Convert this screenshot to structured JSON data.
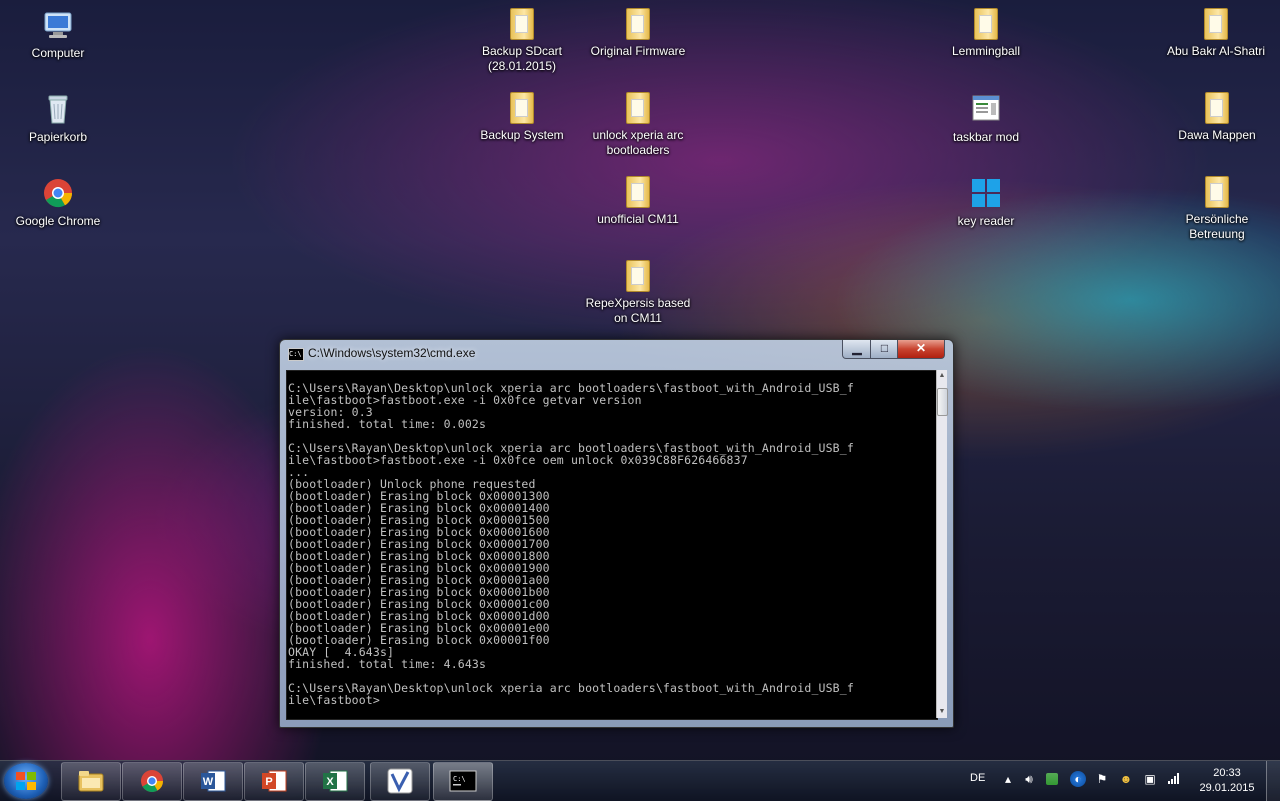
{
  "desktop": {
    "icons": [
      {
        "label": "Computer"
      },
      {
        "label": "Papierkorb"
      },
      {
        "label": "Google Chrome"
      },
      {
        "label": "Backup SDcart\n(28.01.2015)"
      },
      {
        "label": "Original Firmware"
      },
      {
        "label": "Backup System"
      },
      {
        "label": "unlock xperia arc\nbootloaders"
      },
      {
        "label": "unofficial CM11"
      },
      {
        "label": "RepeXpersis based\non CM11"
      },
      {
        "label": "Lemmingball"
      },
      {
        "label": "taskbar mod"
      },
      {
        "label": "key reader"
      },
      {
        "label": "Abu Bakr Al-Shatri"
      },
      {
        "label": "Dawa Mappen"
      },
      {
        "label": "Persönliche\nBetreuung"
      }
    ]
  },
  "cmd": {
    "title": "C:\\Windows\\system32\\cmd.exe",
    "minimize_glyph": "▁",
    "maximize_glyph": "□",
    "close_glyph": "✕",
    "output": "C:\\Users\\Rayan\\Desktop\\unlock xperia arc bootloaders\\fastboot_with_Android_USB_f\nile\\fastboot>fastboot.exe -i 0x0fce getvar version\nversion: 0.3\nfinished. total time: 0.002s\n\nC:\\Users\\Rayan\\Desktop\\unlock xperia arc bootloaders\\fastboot_with_Android_USB_f\nile\\fastboot>fastboot.exe -i 0x0fce oem unlock 0x039C88F626466837\n...\n(bootloader) Unlock phone requested\n(bootloader) Erasing block 0x00001300\n(bootloader) Erasing block 0x00001400\n(bootloader) Erasing block 0x00001500\n(bootloader) Erasing block 0x00001600\n(bootloader) Erasing block 0x00001700\n(bootloader) Erasing block 0x00001800\n(bootloader) Erasing block 0x00001900\n(bootloader) Erasing block 0x00001a00\n(bootloader) Erasing block 0x00001b00\n(bootloader) Erasing block 0x00001c00\n(bootloader) Erasing block 0x00001d00\n(bootloader) Erasing block 0x00001e00\n(bootloader) Erasing block 0x00001f00\nOKAY [  4.643s]\nfinished. total time: 4.643s\n\nC:\\Users\\Rayan\\Desktop\\unlock xperia arc bootloaders\\fastboot_with_Android_USB_f\nile\\fastboot>"
  },
  "taskbar": {
    "language": "DE",
    "time": "20:33",
    "date": "29.01.2015"
  }
}
